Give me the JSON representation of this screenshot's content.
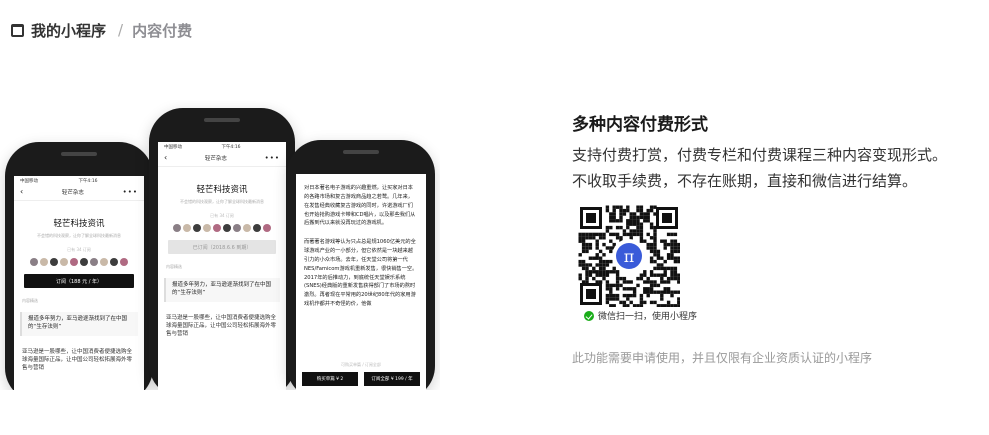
{
  "breadcrumb": {
    "root": "我的小程序",
    "separator": "/",
    "current": "内容付费"
  },
  "phones": {
    "status_left": "中国移动",
    "status_time": "下午4:16",
    "nav_back": "‹",
    "nav_title": "轻芒杂志",
    "nav_more": "•••",
    "magazine_title": "轻芒科技资讯",
    "magazine_sub": "不会错的科技观察，让你了解全球科技最新消息",
    "subscriber_count": "已有 34 订阅",
    "subscribe_button": "订阅（188 元 / 年）",
    "subscribed_button": "已订阅（2018.6.6 到期）",
    "section_label": "内容精选",
    "quote_text": "报道多年努力，亚马逊逐渐找到了在中国的“生存法则”",
    "para_text": "亚马逊是一股哪些，让中国消费者便捷选购全球海量国际正品，让中国公司轻松拓展海外零售与营销",
    "article_p1": "对日本著名电子游戏的兴趣重燃，让买家对日本的各路市场和复古游戏商品趋之若鹜。几年来，在发售经典收藏复古游戏的同时，许诺游戏厂们也开始抢购游戏卡带和CD唱片，以及那些我们从后搬到代以来就没再玩过的游戏机。",
    "article_p2": "而著著名游戏等认为只占总是规1060亿美元的全球游戏产业的一小部分，但它依然是一块越来越引力的小众市场。去年，任天堂公司将第一代NES/Famicom游戏机重新发售，很快销售一空。2017年的后推动力，到底统任天堂娱乐系统(SNES)经典版的重新发售获得部门了市场的熬时激烈。再者现在平常用的20世纪80年代的家用游戏机作都并不奇怪的价，他做",
    "article_hint": "可购买单篇 / 订阅全部",
    "buy_single": "购买单篇 ¥ 2",
    "buy_all": "订阅全部 ¥ 199 / 年"
  },
  "info": {
    "title": "多种内容付费形式",
    "line1": "支持付费打赏，付费专栏和付费课程三种内容变现形式。",
    "line2": "不收取手续费，不存在账期，直接和微信进行结算。",
    "scan_hint": "微信扫一扫，使用小程序",
    "note": "此功能需要申请使用，并且仅限有企业资质认证的小程序"
  },
  "qr": {
    "center_glyph": "π",
    "center_color": "#3a5bd9"
  }
}
